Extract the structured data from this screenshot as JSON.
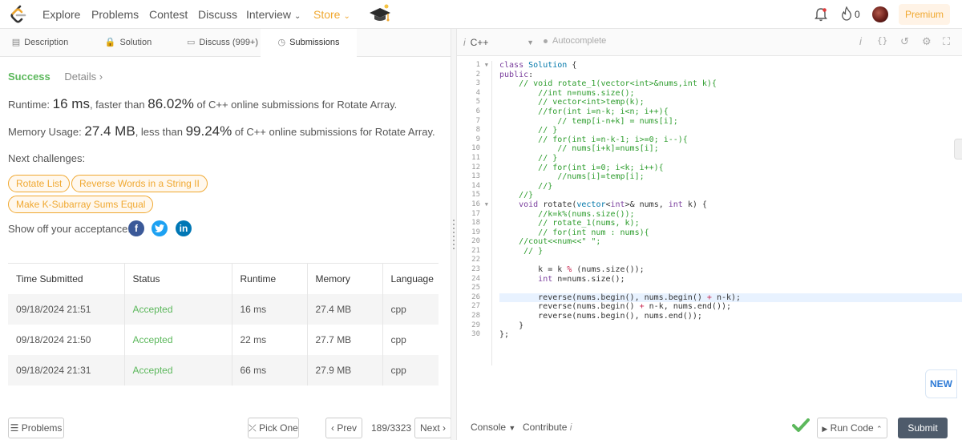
{
  "nav": {
    "items": [
      "Explore",
      "Problems",
      "Contest",
      "Discuss",
      "Interview",
      "Store"
    ],
    "streak_count": "0",
    "premium_label": "Premium"
  },
  "tabs": [
    {
      "label": "Description",
      "icon": "description-icon"
    },
    {
      "label": "Solution",
      "icon": "lock-icon"
    },
    {
      "label": "Discuss (999+)",
      "icon": "discuss-icon"
    },
    {
      "label": "Submissions",
      "icon": "clock-icon"
    }
  ],
  "result": {
    "status": "Success",
    "details": "Details",
    "runtime_prefix": "Runtime:",
    "runtime_value": "16 ms",
    "runtime_mid": ", faster than",
    "runtime_pct": "86.02%",
    "runtime_suffix": "of C++ online submissions for Rotate Array.",
    "memory_prefix": "Memory Usage:",
    "memory_value": "27.4 MB",
    "memory_mid": ", less than",
    "memory_pct": "99.24%",
    "memory_suffix": "of C++ online submissions for Rotate Array."
  },
  "challenges": {
    "label": "Next challenges:",
    "items": [
      "Rotate List",
      "Reverse Words in a String II",
      "Make K-Subarray Sums Equal"
    ]
  },
  "share": {
    "label": "Show off your acceptance:",
    "networks": [
      "f",
      "t",
      "in"
    ]
  },
  "submissions": {
    "headers": [
      "Time Submitted",
      "Status",
      "Runtime",
      "Memory",
      "Language"
    ],
    "rows": [
      [
        "09/18/2024 21:51",
        "Accepted",
        "16 ms",
        "27.4 MB",
        "cpp"
      ],
      [
        "09/18/2024 21:50",
        "Accepted",
        "22 ms",
        "27.7 MB",
        "cpp"
      ],
      [
        "09/18/2024 21:31",
        "Accepted",
        "66 ms",
        "27.9 MB",
        "cpp"
      ]
    ]
  },
  "footer_left": {
    "problems": "Problems",
    "pick_one": "Pick One",
    "prev": "Prev",
    "page": "189/3323",
    "next": "Next"
  },
  "editor": {
    "language": "C++",
    "autocomplete": "Autocomplete",
    "lines": [
      "class Solution {",
      "public:",
      "    // void rotate_1(vector<int>&nums,int k){",
      "        //int n=nums.size();",
      "        // vector<int>temp(k);",
      "        //for(int i=n-k; i<n; i++){",
      "            // temp[i-n+k] = nums[i];",
      "        // }",
      "        // for(int i=n-k-1; i>=0; i--){",
      "            // nums[i+k]=nums[i];",
      "        // }",
      "        // for(int i=0; i<k; i++){",
      "            //nums[i]=temp[i];",
      "        //}",
      "    //}",
      "    void rotate(vector<int>& nums, int k) {",
      "        //k=k%(nums.size());",
      "        // rotate_1(nums, k);",
      "        // for(int num : nums){",
      "    //cout<<num<<\" \";",
      "     // }",
      "",
      "        k = k % (nums.size());",
      "        int n=nums.size();",
      "",
      "        reverse(nums.begin(), nums.begin() + n-k);",
      "        reverse(nums.begin() + n-k, nums.end());",
      "        reverse(nums.begin(), nums.end());",
      "    }",
      "};"
    ],
    "new_badge": "NEW",
    "console": "Console",
    "contribute": "Contribute",
    "run_code": "Run Code",
    "submit": "Submit"
  },
  "colors": {
    "accent": "#f0a830",
    "success": "#5cb85c",
    "submit_bg": "#4e5b6b",
    "facebook": "#3b5998",
    "twitter": "#1da1f2",
    "linkedin": "#0077b5"
  }
}
